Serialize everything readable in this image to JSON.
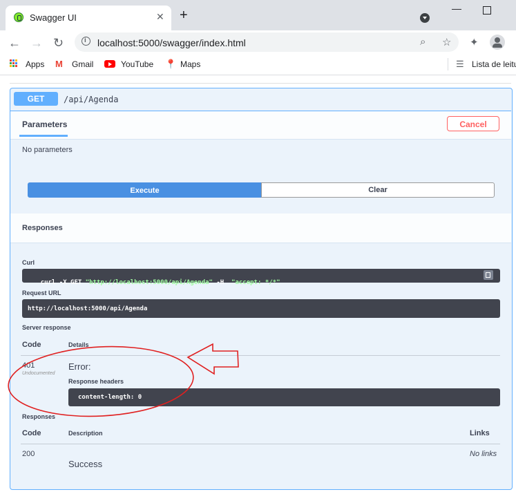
{
  "browser": {
    "tab_title": "Swagger UI",
    "url": "localhost:5000/swagger/index.html",
    "bookmarks": [
      {
        "label": "Apps",
        "icon": "apps-grid-icon"
      },
      {
        "label": "Gmail",
        "icon": "gmail-icon"
      },
      {
        "label": "YouTube",
        "icon": "youtube-icon"
      },
      {
        "label": "Maps",
        "icon": "maps-icon"
      }
    ],
    "reading_list": "Lista de leitu"
  },
  "operation": {
    "method": "GET",
    "path": "/api/Agenda",
    "parameters_tab": "Parameters",
    "cancel_label": "Cancel",
    "no_parameters": "No parameters",
    "execute_label": "Execute",
    "clear_label": "Clear",
    "responses_title": "Responses"
  },
  "live_response": {
    "curl_label": "Curl",
    "curl_cmd_prefix": "curl -X GET ",
    "curl_url": "\"http://localhost:5000/api/Agenda\"",
    "curl_flag": " -H  ",
    "curl_header": "\"accept: */*\"",
    "request_url_label": "Request URL",
    "request_url": "http://localhost:5000/api/Agenda",
    "server_response_label": "Server response",
    "code_header": "Code",
    "details_header": "Details",
    "status_code": "401",
    "status_note": "Undocumented",
    "error_text": "Error:",
    "response_headers_label": "Response headers",
    "response_headers_value": "content-length: 0"
  },
  "documented_responses": {
    "title": "Responses",
    "code_header": "Code",
    "description_header": "Description",
    "links_header": "Links",
    "rows": [
      {
        "code": "200",
        "description": "Success",
        "links": "No links"
      }
    ]
  },
  "colors": {
    "get_accent": "#61affe",
    "execute_blue": "#4990e2",
    "cancel_red": "#ff6060",
    "annotation_red": "#e02020"
  }
}
